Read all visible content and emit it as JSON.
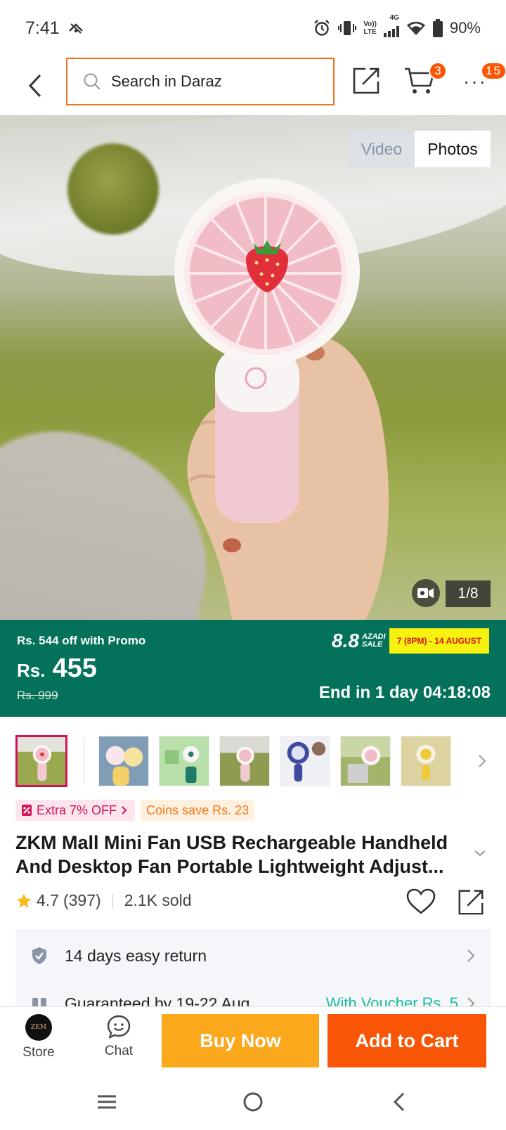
{
  "status_bar": {
    "time": "7:41",
    "net_top": "Vo))",
    "net_bottom": "LTE",
    "net_type": "4G",
    "battery": "90%"
  },
  "header": {
    "search_placeholder": "Search in Daraz",
    "cart_count": "3",
    "more_count": "15"
  },
  "gallery": {
    "toggle_video": "Video",
    "toggle_photos": "Photos",
    "counter": "1/8",
    "thumbnail_count": 7
  },
  "price_banner": {
    "promo_text": "Rs. 544 off with Promo",
    "currency": "Rs.",
    "price": "455",
    "original_price": "Rs. 999",
    "sale_name": "8.8",
    "sale_tag_top": "AZADI",
    "sale_tag_bottom": "SALE",
    "sale_dates": "7 (8PM) - 14 AUGUST",
    "end_timer": "End in 1 day 04:18:08"
  },
  "tags": {
    "extra_off": "Extra 7% OFF",
    "coins": "Coins save Rs. 23"
  },
  "product": {
    "title": "ZKM Mall Mini Fan USB Rechargeable Handheld And Desktop Fan Portable Lightweight Adjust...",
    "rating": "4.7",
    "review_count": "(397)",
    "sold": "2.1K sold"
  },
  "info": {
    "return_policy": "14 days easy return",
    "delivery": "Guaranteed by 19-22 Aug",
    "voucher": "With Voucher Rs. 5"
  },
  "action_bar": {
    "store_label": "Store",
    "store_logo_text": "ZKM",
    "chat_label": "Chat",
    "buy_now": "Buy Now",
    "add_to_cart": "Add to Cart"
  },
  "colors": {
    "brand_orange": "#f85606",
    "buy_now_yellow": "#fba81c",
    "banner_green": "#04715a",
    "search_border": "#f0731c",
    "promo_pink": "#d3145a"
  },
  "icons": [
    "back-icon",
    "search-icon",
    "share-icon",
    "cart-icon",
    "more-icon",
    "video-icon",
    "chevron-right-icon",
    "voucher-icon",
    "chevron-down-icon",
    "star-icon",
    "heart-icon",
    "shield-icon",
    "chat-icon",
    "menu-icon",
    "home-icon",
    "back-nav-icon"
  ]
}
